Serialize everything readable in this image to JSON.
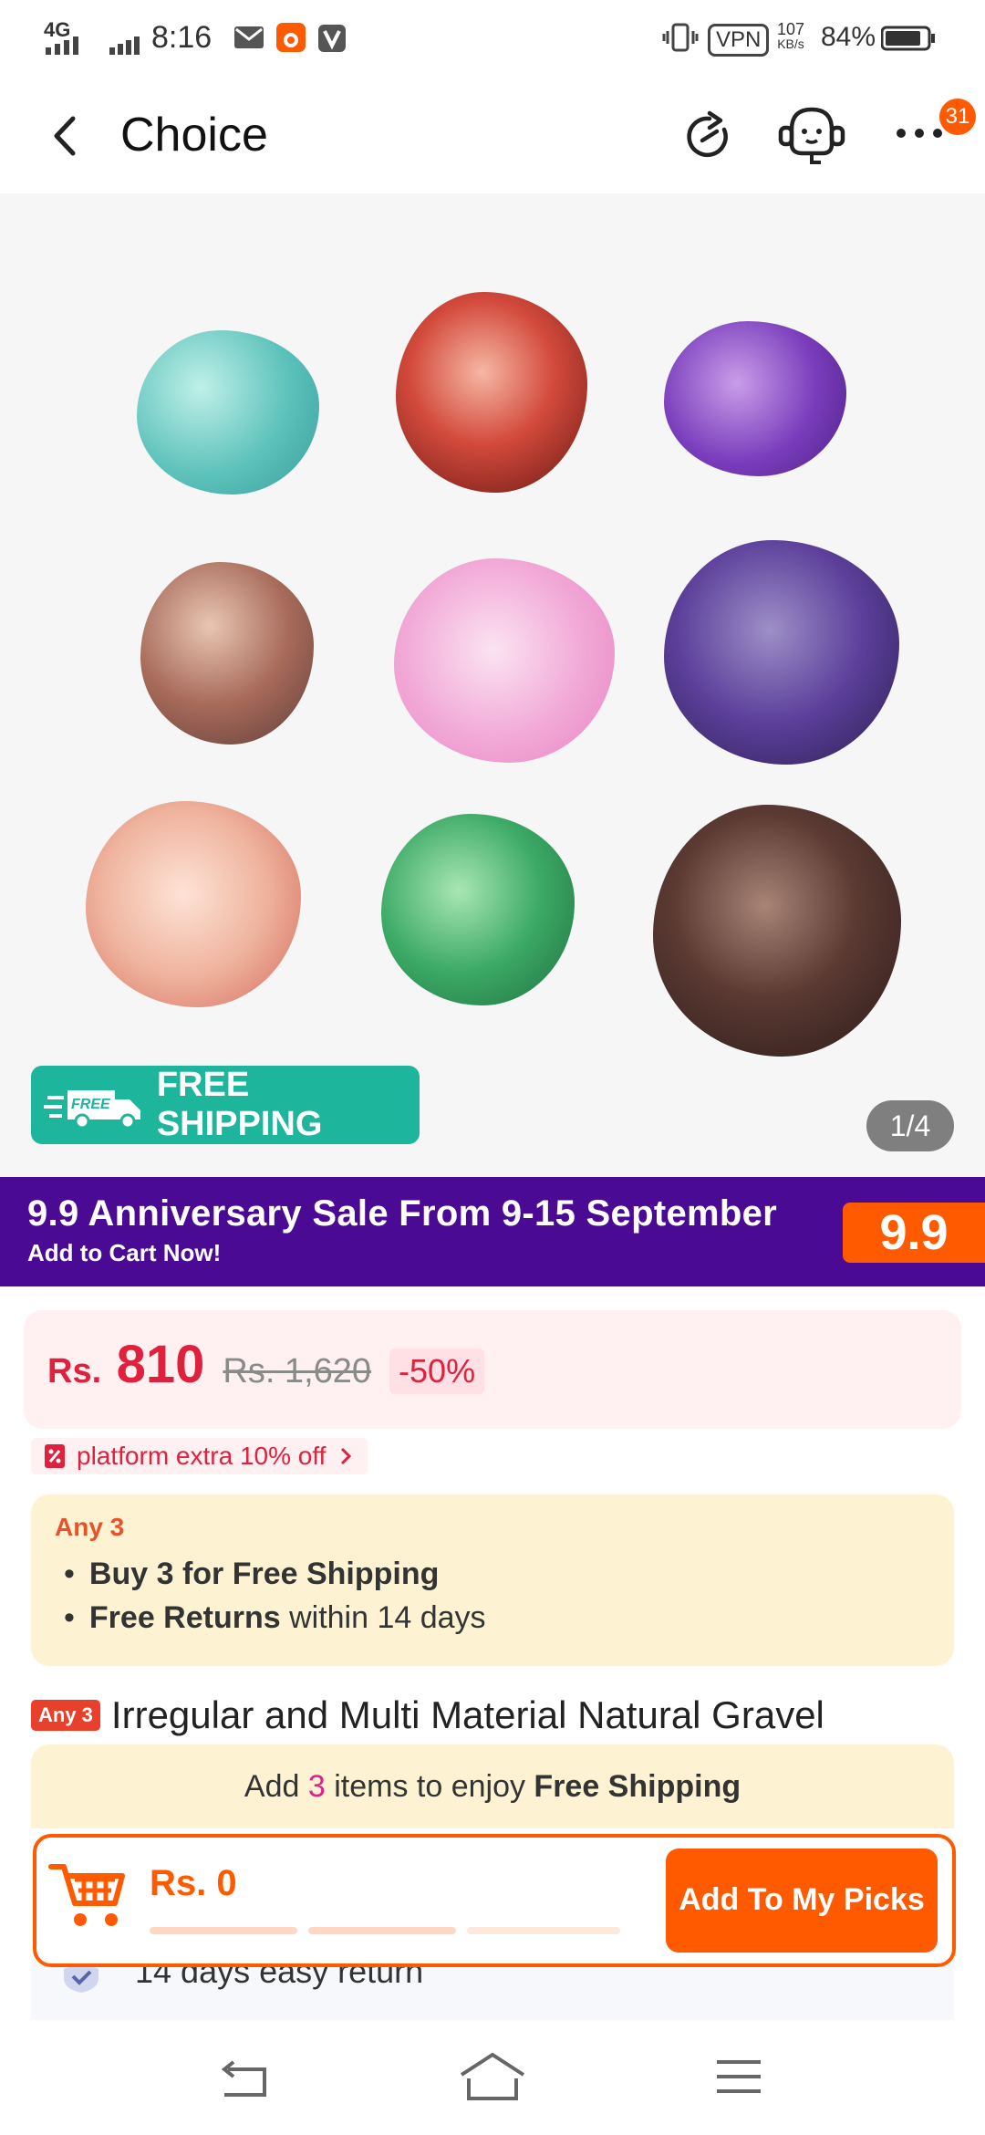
{
  "status_bar": {
    "network": "4G",
    "time": "8:16",
    "vpn": "VPN",
    "speed_value": "107",
    "speed_unit": "KB/s",
    "battery": "84%"
  },
  "app_bar": {
    "title": "Choice",
    "badge_count": "31",
    "icons": [
      "back-icon",
      "share-icon",
      "support-icon",
      "more-icon"
    ]
  },
  "gallery": {
    "free_shipping_label": "FREE SHIPPING",
    "free_truck_label": "FREE",
    "counter": "1/4"
  },
  "promo": {
    "title": "9.9 Anniversary Sale From 9-15 September",
    "subtitle": "Add to Cart Now!",
    "badge": "9.9",
    "bg_color": "#4a0a93",
    "badge_color": "#ff5a00"
  },
  "price": {
    "currency": "Rs.",
    "current": "810",
    "original": "Rs. 1,620",
    "discount": "-50%",
    "accent": "#e0213d"
  },
  "coupon": {
    "label": "platform extra 10% off"
  },
  "offer": {
    "tag": "Any 3",
    "bullets": [
      {
        "bold": "Buy 3 for  Free Shipping",
        "rest": ""
      },
      {
        "bold": "Free Returns",
        "rest": " within 14 days"
      }
    ]
  },
  "product": {
    "tag": "Any 3",
    "title": "Irregular and Multi Material Natural Gravel"
  },
  "cart_bar": {
    "prefix": "Add ",
    "count": "3",
    "middle": " items to enjoy ",
    "bold": "Free Shipping",
    "amount": "Rs. 0",
    "cta": "Add To My Picks",
    "accent": "#ff5a00"
  },
  "return_row": {
    "text": "14 days easy return"
  }
}
